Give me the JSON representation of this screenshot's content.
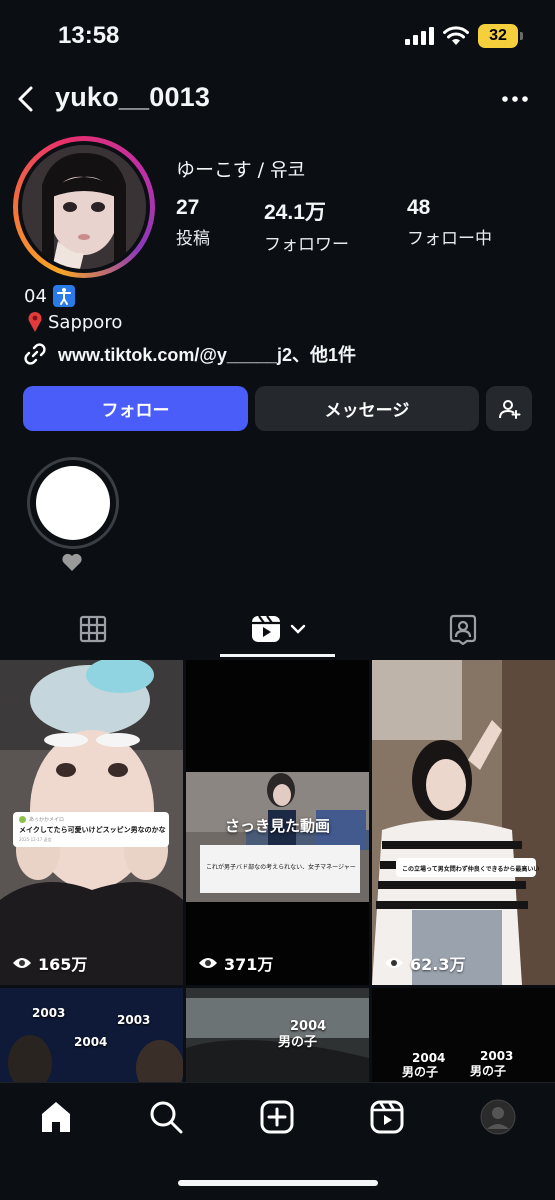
{
  "status_bar": {
    "time": "13:58",
    "battery": "32"
  },
  "header": {
    "username": "yuko__0013"
  },
  "profile": {
    "display_name": "ゆーこす / 유코",
    "stats": [
      {
        "count": "27",
        "label": "投稿"
      },
      {
        "count": "24.1万",
        "label": "フォロワー"
      },
      {
        "count": "48",
        "label": "フォロー中"
      }
    ],
    "bio_line1": "04",
    "bio_line2": "Sapporo",
    "link": "www.tiktok.com/@y_____j2、他1件"
  },
  "buttons": {
    "follow": "フォロー",
    "message": "メッセージ"
  },
  "highlight": {
    "label": "🤍"
  },
  "tabs": [
    "grid",
    "reels",
    "tagged"
  ],
  "grid": [
    {
      "views": "165万",
      "comment_user": "あっかかメイロ",
      "comment": "メイクしてたら可愛いけどスッピン男なのかな",
      "comment_meta": "2025-12-17  返信"
    },
    {
      "views": "371万",
      "overlay": "さっき見た動画",
      "comment": "これが男子バド部なの考えられない、女子マネージャーやん"
    },
    {
      "views": "62.3万",
      "comment": "この立場って男女問わず仲良くできるから最高いい"
    },
    {
      "tags": [
        "2003",
        "2004",
        "2003"
      ]
    },
    {
      "tags": [
        "2004",
        "男の子"
      ]
    },
    {
      "tags": [
        "2004",
        "男の子",
        "2003",
        "男の子"
      ]
    }
  ],
  "nav": [
    "home",
    "search",
    "create",
    "reels",
    "profile"
  ],
  "colors": {
    "accent": "#4a5df9",
    "background": "#0b0f14",
    "button_dark": "#25292e"
  }
}
